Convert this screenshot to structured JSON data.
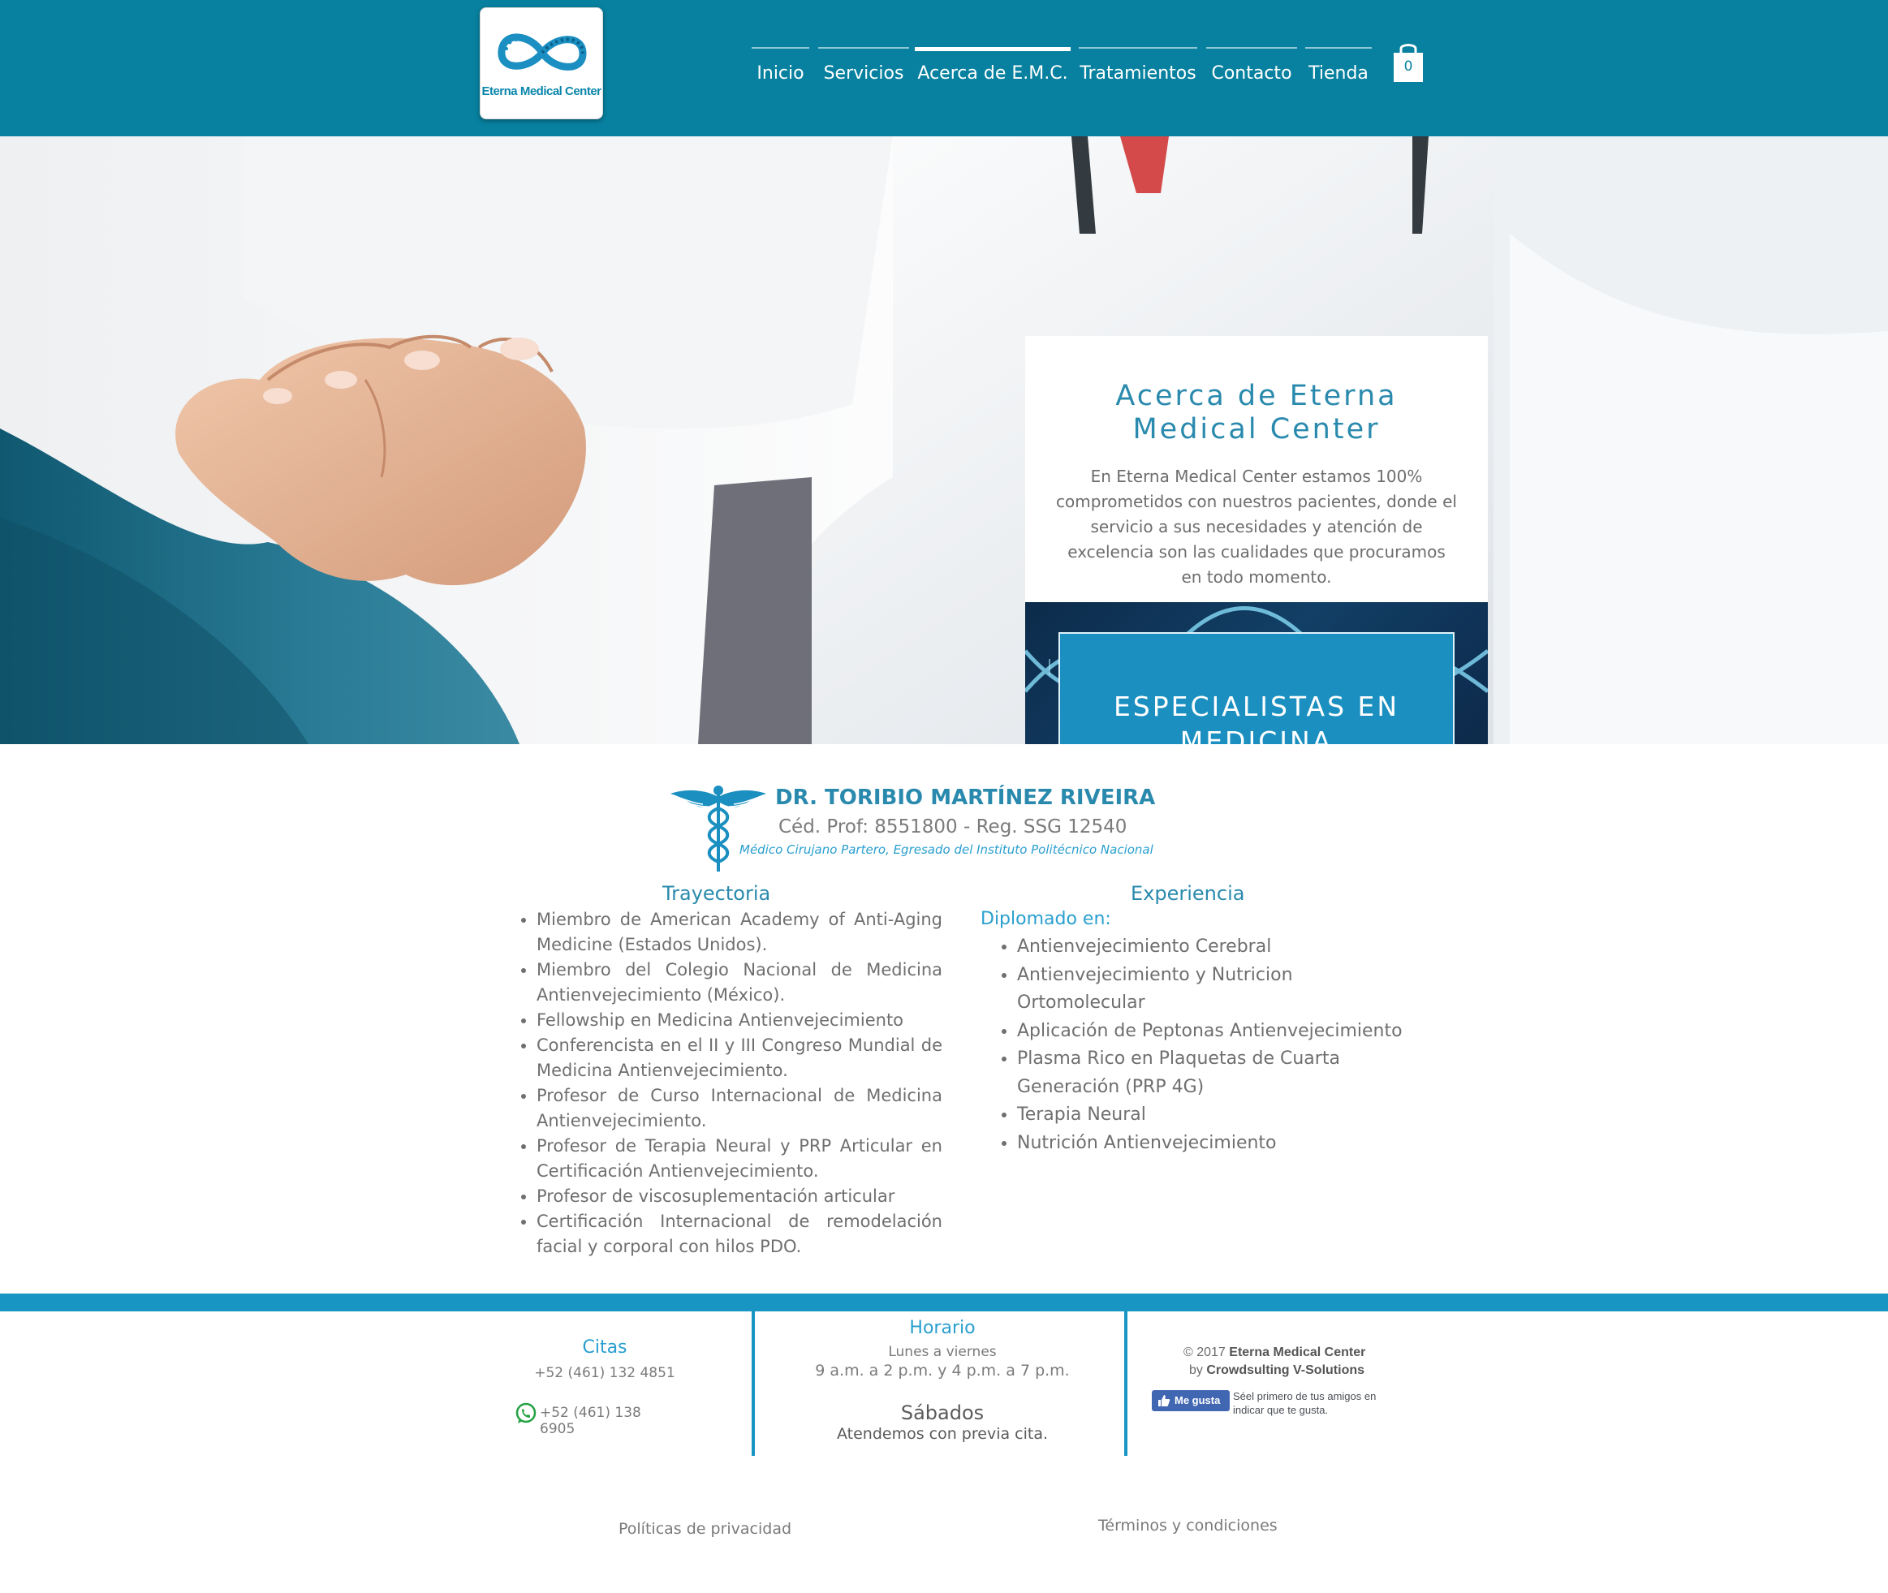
{
  "header": {
    "logo_text": "Eterna Medical Center",
    "nav": [
      {
        "label": "Inicio",
        "active": false
      },
      {
        "label": "Servicios",
        "active": false
      },
      {
        "label": "Acerca de E.M.C.",
        "active": true
      },
      {
        "label": "Tratamientos",
        "active": false
      },
      {
        "label": "Contacto",
        "active": false
      },
      {
        "label": "Tienda",
        "active": false
      }
    ],
    "cart_count": "0",
    "cart_icon": "shopping-bag-icon"
  },
  "hero": {
    "about_title": "Acerca de Eterna Medical Center",
    "about_text": "En Eterna Medical Center estamos 100% comprometidos con nuestros pacientes, donde el servicio a sus necesidades y atención de excelencia son las cualidades que procuramos en todo momento.",
    "specialists": "ESPECIALISTAS EN MEDICINA ANTIENVEJECIMIENTO"
  },
  "doctor": {
    "name": "DR. TORIBIO MARTÍNEZ RIVEIRA",
    "cedula": "Céd. Prof: 8551800 - Reg. SSG 12540",
    "description": "Médico Cirujano Partero, Egresado del Instituto Politécnico Nacional"
  },
  "trayectoria": {
    "title": "Trayectoria",
    "items": [
      "Miembro de American Academy of Anti-Aging Medicine (Estados Unidos).",
      "Miembro del Colegio Nacional de Medicina Antienvejecimiento (México).",
      "Fellowship en Medicina Antienvejecimiento",
      "Conferencista en el II y III Congreso Mundial de Medicina Antienvejecimiento.",
      "Profesor de Curso Internacional de Medicina Antienvejecimiento.",
      "Profesor de Terapia Neural y PRP Articular en Certificación Antienvejecimiento.",
      "Profesor de viscosuplementación articular",
      "Certificación Internacional de remodelación facial y corporal con hilos PDO."
    ]
  },
  "experiencia": {
    "title": "Experiencia",
    "subtitle": "Diplomado en:",
    "items": [
      "Antienvejecimiento Cerebral",
      "Antienvejecimiento y Nutricion Ortomolecular",
      "Aplicación de Peptonas Antienvejecimiento",
      "Plasma Rico en Plaquetas de Cuarta Generación (PRP 4G)",
      "Terapia Neural",
      "Nutrición Antienvejecimiento"
    ]
  },
  "footer": {
    "citas_title": "Citas",
    "phone1": "+52 (461) 132 4851",
    "phone2": "+52 (461) 138 6905",
    "horario_title": "Horario",
    "weekdays_label": "Lunes a viernes",
    "weekdays_hours": "9 a.m. a 2 p.m. y 4 p.m. a 7 p.m.",
    "saturday_label": "Sábados",
    "saturday_note": "Atendemos con previa cita.",
    "copyright_prefix": "© 2017",
    "copyright_company": "Eterna Medical Center",
    "by_prefix": "by",
    "by_company": "Crowdsulting V-Solutions",
    "like_button": "Me gusta",
    "like_text": "Séel primero de tus amigos en indicar que te gusta.",
    "privacy_link": "Políticas de privacidad",
    "terms_link": "Términos y condiciones"
  },
  "colors": {
    "header_bg": "#07819f",
    "accent": "#2a8aad",
    "footer_accent": "#1995c4",
    "specialists_box": "#1a8fc0"
  }
}
